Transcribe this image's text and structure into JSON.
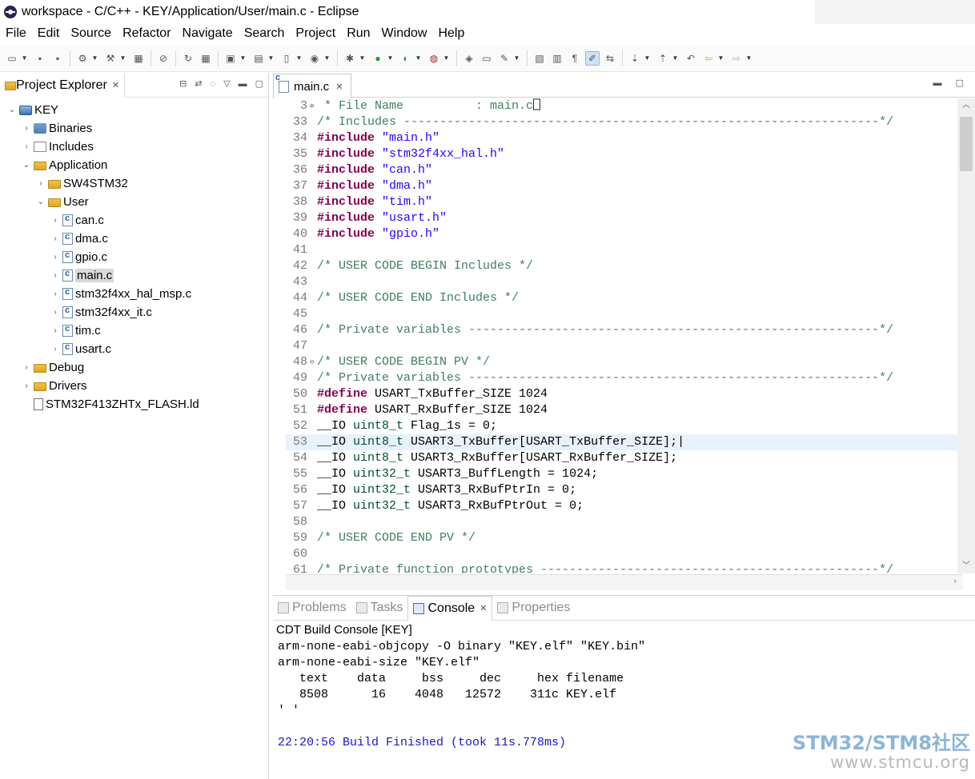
{
  "window": {
    "title": "workspace - C/C++ - KEY/Application/User/main.c - Eclipse"
  },
  "menu": [
    "File",
    "Edit",
    "Source",
    "Refactor",
    "Navigate",
    "Search",
    "Project",
    "Run",
    "Window",
    "Help"
  ],
  "explorer": {
    "tab_label": "Project Explorer",
    "tree": [
      {
        "label": "KEY",
        "depth": 0,
        "arrow": "v",
        "icon": "project-icon"
      },
      {
        "label": "Binaries",
        "depth": 1,
        "arrow": ">",
        "icon": "binaries-icon"
      },
      {
        "label": "Includes",
        "depth": 1,
        "arrow": ">",
        "icon": "includes-icon"
      },
      {
        "label": "Application",
        "depth": 1,
        "arrow": "v",
        "icon": "folder-icon"
      },
      {
        "label": "SW4STM32",
        "depth": 2,
        "arrow": ">",
        "icon": "folder-icon"
      },
      {
        "label": "User",
        "depth": 2,
        "arrow": "v",
        "icon": "folder-icon"
      },
      {
        "label": "can.c",
        "depth": 3,
        "arrow": ">",
        "icon": "c-file-icon"
      },
      {
        "label": "dma.c",
        "depth": 3,
        "arrow": ">",
        "icon": "c-file-icon"
      },
      {
        "label": "gpio.c",
        "depth": 3,
        "arrow": ">",
        "icon": "c-file-icon"
      },
      {
        "label": "main.c",
        "depth": 3,
        "arrow": ">",
        "icon": "c-file-icon",
        "selected": true
      },
      {
        "label": "stm32f4xx_hal_msp.c",
        "depth": 3,
        "arrow": ">",
        "icon": "c-file-icon"
      },
      {
        "label": "stm32f4xx_it.c",
        "depth": 3,
        "arrow": ">",
        "icon": "c-file-icon"
      },
      {
        "label": "tim.c",
        "depth": 3,
        "arrow": ">",
        "icon": "c-file-icon"
      },
      {
        "label": "usart.c",
        "depth": 3,
        "arrow": ">",
        "icon": "c-file-icon"
      },
      {
        "label": "Debug",
        "depth": 1,
        "arrow": ">",
        "icon": "folder-icon"
      },
      {
        "label": "Drivers",
        "depth": 1,
        "arrow": ">",
        "icon": "folder-icon"
      },
      {
        "label": "STM32F413ZHTx_FLASH.ld",
        "depth": 1,
        "arrow": "",
        "icon": "linker-file-icon"
      }
    ]
  },
  "editor": {
    "tab_label": "main.c",
    "lines": [
      {
        "n": "3",
        "fold": "+",
        "segs": [
          {
            "c": "cmt",
            "t": " * File Name          : main.c"
          },
          {
            "c": "",
            "t": "⎕"
          }
        ]
      },
      {
        "n": "33",
        "segs": [
          {
            "c": "cmt",
            "t": "/* Includes ------------------------------------------------------------------*/"
          }
        ]
      },
      {
        "n": "34",
        "segs": [
          {
            "c": "kw",
            "t": "#include"
          },
          {
            "c": "",
            "t": " "
          },
          {
            "c": "str",
            "t": "\"main.h\""
          }
        ]
      },
      {
        "n": "35",
        "segs": [
          {
            "c": "kw",
            "t": "#include"
          },
          {
            "c": "",
            "t": " "
          },
          {
            "c": "str",
            "t": "\"stm32f4xx_hal.h\""
          }
        ]
      },
      {
        "n": "36",
        "segs": [
          {
            "c": "kw",
            "t": "#include"
          },
          {
            "c": "",
            "t": " "
          },
          {
            "c": "str",
            "t": "\"can.h\""
          }
        ]
      },
      {
        "n": "37",
        "segs": [
          {
            "c": "kw",
            "t": "#include"
          },
          {
            "c": "",
            "t": " "
          },
          {
            "c": "str",
            "t": "\"dma.h\""
          }
        ]
      },
      {
        "n": "38",
        "segs": [
          {
            "c": "kw",
            "t": "#include"
          },
          {
            "c": "",
            "t": " "
          },
          {
            "c": "str",
            "t": "\"tim.h\""
          }
        ]
      },
      {
        "n": "39",
        "segs": [
          {
            "c": "kw",
            "t": "#include"
          },
          {
            "c": "",
            "t": " "
          },
          {
            "c": "str",
            "t": "\"usart.h\""
          }
        ]
      },
      {
        "n": "40",
        "segs": [
          {
            "c": "kw",
            "t": "#include"
          },
          {
            "c": "",
            "t": " "
          },
          {
            "c": "str",
            "t": "\"gpio.h\""
          }
        ]
      },
      {
        "n": "41",
        "segs": []
      },
      {
        "n": "42",
        "segs": [
          {
            "c": "cmt",
            "t": "/* USER CODE BEGIN Includes */"
          }
        ]
      },
      {
        "n": "43",
        "segs": []
      },
      {
        "n": "44",
        "segs": [
          {
            "c": "cmt",
            "t": "/* USER CODE END Includes */"
          }
        ]
      },
      {
        "n": "45",
        "segs": []
      },
      {
        "n": "46",
        "segs": [
          {
            "c": "cmt",
            "t": "/* Private variables ---------------------------------------------------------*/"
          }
        ]
      },
      {
        "n": "47",
        "segs": []
      },
      {
        "n": "48",
        "fold": "-",
        "segs": [
          {
            "c": "cmt",
            "t": "/* USER CODE BEGIN PV */"
          }
        ]
      },
      {
        "n": "49",
        "segs": [
          {
            "c": "cmt",
            "t": "/* Private variables ---------------------------------------------------------*/"
          }
        ]
      },
      {
        "n": "50",
        "segs": [
          {
            "c": "kw",
            "t": "#define"
          },
          {
            "c": "",
            "t": " USART_TxBuffer_SIZE 1024"
          }
        ]
      },
      {
        "n": "51",
        "segs": [
          {
            "c": "kw",
            "t": "#define"
          },
          {
            "c": "",
            "t": " USART_RxBuffer_SIZE 1024"
          }
        ]
      },
      {
        "n": "52",
        "segs": [
          {
            "c": "",
            "t": "__IO "
          },
          {
            "c": "typ",
            "t": "uint8_t"
          },
          {
            "c": "",
            "t": " Flag_1s = 0;"
          }
        ]
      },
      {
        "n": "53",
        "current": true,
        "segs": [
          {
            "c": "",
            "t": "__IO "
          },
          {
            "c": "typ",
            "t": "uint8_t"
          },
          {
            "c": "",
            "t": " USART3_TxBuffer[USART_TxBuffer_SIZE];|"
          }
        ]
      },
      {
        "n": "54",
        "segs": [
          {
            "c": "",
            "t": "__IO "
          },
          {
            "c": "typ",
            "t": "uint8_t"
          },
          {
            "c": "",
            "t": " USART3_RxBuffer[USART_RxBuffer_SIZE];"
          }
        ]
      },
      {
        "n": "55",
        "segs": [
          {
            "c": "",
            "t": "__IO "
          },
          {
            "c": "typ",
            "t": "uint32_t"
          },
          {
            "c": "",
            "t": " USART3_BuffLength = 1024;"
          }
        ]
      },
      {
        "n": "56",
        "segs": [
          {
            "c": "",
            "t": "__IO "
          },
          {
            "c": "typ",
            "t": "uint32_t"
          },
          {
            "c": "",
            "t": " USART3_RxBufPtrIn = 0;"
          }
        ]
      },
      {
        "n": "57",
        "segs": [
          {
            "c": "",
            "t": "__IO "
          },
          {
            "c": "typ",
            "t": "uint32_t"
          },
          {
            "c": "",
            "t": " USART3_RxBufPtrOut = 0;"
          }
        ]
      },
      {
        "n": "58",
        "segs": []
      },
      {
        "n": "59",
        "segs": [
          {
            "c": "cmt",
            "t": "/* USER CODE END PV */"
          }
        ]
      },
      {
        "n": "60",
        "segs": []
      },
      {
        "n": "61",
        "segs": [
          {
            "c": "cmt",
            "t": "/* Private function prototypes -----------------------------------------------*/"
          }
        ]
      }
    ]
  },
  "console": {
    "tabs": [
      {
        "label": "Problems",
        "active": false
      },
      {
        "label": "Tasks",
        "active": false
      },
      {
        "label": "Console",
        "active": true
      },
      {
        "label": "Properties",
        "active": false
      }
    ],
    "subtitle": "CDT Build Console [KEY]",
    "lines": [
      {
        "t": "arm-none-eabi-objcopy -O binary \"KEY.elf\" \"KEY.bin\"",
        "blue": false
      },
      {
        "t": "arm-none-eabi-size \"KEY.elf\"",
        "blue": false
      },
      {
        "t": "   text    data     bss     dec     hex filename",
        "blue": false
      },
      {
        "t": "   8508      16    4048   12572    311c KEY.elf",
        "blue": false
      },
      {
        "t": "' '",
        "blue": false
      },
      {
        "t": "",
        "blue": false
      },
      {
        "t": "22:20:56 Build Finished (took 11s.778ms)",
        "blue": true
      }
    ]
  },
  "watermark": {
    "line1": "STM32/STM8社区",
    "line2": "www.stmcu.org"
  },
  "colors": {
    "keyword": "#7f0055",
    "string": "#2a00ff",
    "comment": "#3f7f5f",
    "type": "#005032",
    "console_blue": "#1a18c8",
    "current_line": "#e8f2fe"
  }
}
